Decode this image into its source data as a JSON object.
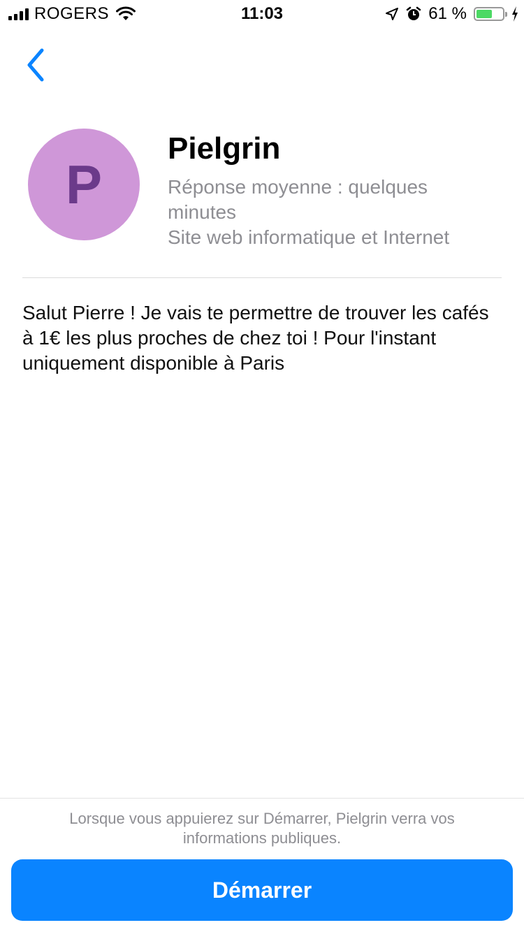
{
  "status_bar": {
    "carrier": "ROGERS",
    "time": "11:03",
    "battery_percent": "61 %",
    "battery_level": 0.61,
    "icons": [
      "signal-icon",
      "wifi-icon",
      "location-arrow-icon",
      "alarm-icon",
      "battery-icon",
      "charging-bolt-icon"
    ]
  },
  "nav": {
    "back_icon": "chevron-left-icon"
  },
  "profile": {
    "avatar_letter": "P",
    "avatar_color": "#cf97d8",
    "name": "Pielgrin",
    "response_time": "Réponse moyenne : quelques minutes",
    "category": "Site web informatique et Internet"
  },
  "greeting": "Salut Pierre ! Je vais te permettre de trouver les cafés à 1€ les plus proches de chez toi ! Pour l'instant uniquement disponible à Paris",
  "footer": {
    "note": "Lorsque vous appuierez sur Démarrer, Pielgrin verra vos informations publiques.",
    "start_label": "Démarrer",
    "accent_color": "#0a84ff"
  }
}
